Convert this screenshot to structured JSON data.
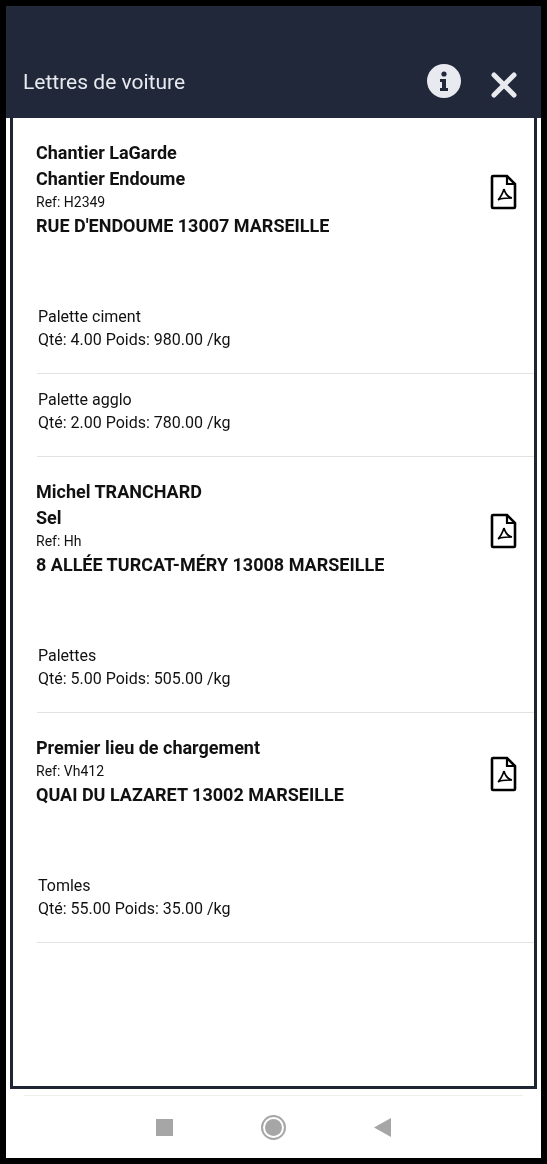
{
  "header": {
    "title": "Lettres de voiture"
  },
  "stops": [
    {
      "lines": [
        "Chantier LaGarde",
        "Chantier Endoume"
      ],
      "ref": "Ref: H2349",
      "address": "RUE D'ENDOUME 13007 MARSEILLE",
      "items": [
        {
          "name": "Palette ciment",
          "detail": "Qté: 4.00 Poids: 980.00 /kg"
        },
        {
          "name": "Palette agglo",
          "detail": "Qté: 2.00 Poids: 780.00 /kg"
        }
      ]
    },
    {
      "lines": [
        "Michel TRANCHARD",
        "Sel"
      ],
      "ref": "Ref: Hh",
      "address": "8 ALLÉE TURCAT-MÉRY 13008 MARSEILLE",
      "items": [
        {
          "name": "Palettes",
          "detail": "Qté: 5.00 Poids: 505.00 /kg"
        }
      ]
    },
    {
      "lines": [
        "Premier lieu de chargement"
      ],
      "ref": "Ref: Vh412",
      "address": "QUAI DU LAZARET 13002 MARSEILLE",
      "items": [
        {
          "name": "Tomles",
          "detail": "Qté: 55.00 Poids: 35.00 /kg"
        }
      ]
    }
  ]
}
